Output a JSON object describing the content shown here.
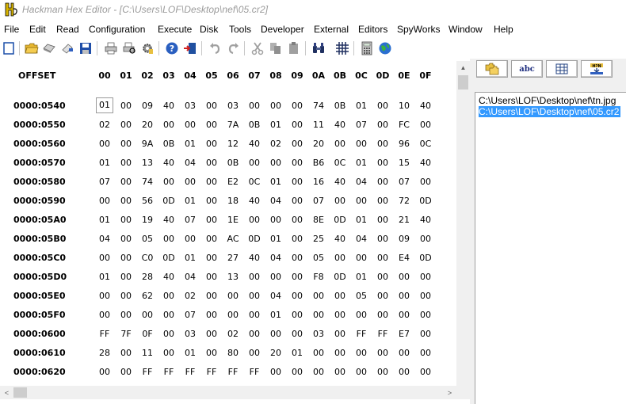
{
  "window": {
    "title": "Hackman Hex Editor - [C:\\Users\\LOF\\Desktop\\nef\\05.cr2]"
  },
  "menu": [
    "File",
    "Edit",
    "Read",
    "Configuration",
    "Execute",
    "Disk",
    "Tools",
    "Developer",
    "External",
    "Editors",
    "SpyWorks",
    "Window",
    "Help"
  ],
  "toolbar": {
    "icons": [
      "new-file-icon",
      "open-folder-icon",
      "disk-icon",
      "eraser-icon",
      "save-icon",
      "print-icon",
      "print-preview-icon",
      "settings-icon",
      "help-icon",
      "exit-icon",
      "undo-icon",
      "redo-icon",
      "cut-icon",
      "copy-icon",
      "paste-icon",
      "find-icon",
      "grid-icon",
      "calculator-icon",
      "globe-icon"
    ]
  },
  "hex": {
    "offset_header": "OFFSET",
    "columns": [
      "00",
      "01",
      "02",
      "03",
      "04",
      "05",
      "06",
      "07",
      "08",
      "09",
      "0A",
      "0B",
      "0C",
      "0D",
      "0E",
      "0F"
    ],
    "rows": [
      {
        "offset": "0000:0540",
        "bytes": [
          "01",
          "00",
          "09",
          "40",
          "03",
          "00",
          "03",
          "00",
          "00",
          "00",
          "74",
          "0B",
          "01",
          "00",
          "10",
          "40"
        ]
      },
      {
        "offset": "0000:0550",
        "bytes": [
          "02",
          "00",
          "20",
          "00",
          "00",
          "00",
          "7A",
          "0B",
          "01",
          "00",
          "11",
          "40",
          "07",
          "00",
          "FC",
          "00"
        ]
      },
      {
        "offset": "0000:0560",
        "bytes": [
          "00",
          "00",
          "9A",
          "0B",
          "01",
          "00",
          "12",
          "40",
          "02",
          "00",
          "20",
          "00",
          "00",
          "00",
          "96",
          "0C"
        ]
      },
      {
        "offset": "0000:0570",
        "bytes": [
          "01",
          "00",
          "13",
          "40",
          "04",
          "00",
          "0B",
          "00",
          "00",
          "00",
          "B6",
          "0C",
          "01",
          "00",
          "15",
          "40"
        ]
      },
      {
        "offset": "0000:0580",
        "bytes": [
          "07",
          "00",
          "74",
          "00",
          "00",
          "00",
          "E2",
          "0C",
          "01",
          "00",
          "16",
          "40",
          "04",
          "00",
          "07",
          "00"
        ]
      },
      {
        "offset": "0000:0590",
        "bytes": [
          "00",
          "00",
          "56",
          "0D",
          "01",
          "00",
          "18",
          "40",
          "04",
          "00",
          "07",
          "00",
          "00",
          "00",
          "72",
          "0D"
        ]
      },
      {
        "offset": "0000:05A0",
        "bytes": [
          "01",
          "00",
          "19",
          "40",
          "07",
          "00",
          "1E",
          "00",
          "00",
          "00",
          "8E",
          "0D",
          "01",
          "00",
          "21",
          "40"
        ]
      },
      {
        "offset": "0000:05B0",
        "bytes": [
          "04",
          "00",
          "05",
          "00",
          "00",
          "00",
          "AC",
          "0D",
          "01",
          "00",
          "25",
          "40",
          "04",
          "00",
          "09",
          "00"
        ]
      },
      {
        "offset": "0000:05C0",
        "bytes": [
          "00",
          "00",
          "C0",
          "0D",
          "01",
          "00",
          "27",
          "40",
          "04",
          "00",
          "05",
          "00",
          "00",
          "00",
          "E4",
          "0D"
        ]
      },
      {
        "offset": "0000:05D0",
        "bytes": [
          "01",
          "00",
          "28",
          "40",
          "04",
          "00",
          "13",
          "00",
          "00",
          "00",
          "F8",
          "0D",
          "01",
          "00",
          "00",
          "00"
        ]
      },
      {
        "offset": "0000:05E0",
        "bytes": [
          "00",
          "00",
          "62",
          "00",
          "02",
          "00",
          "00",
          "00",
          "04",
          "00",
          "00",
          "00",
          "05",
          "00",
          "00",
          "00"
        ]
      },
      {
        "offset": "0000:05F0",
        "bytes": [
          "00",
          "00",
          "00",
          "00",
          "07",
          "00",
          "00",
          "00",
          "01",
          "00",
          "00",
          "00",
          "00",
          "00",
          "00",
          "00"
        ]
      },
      {
        "offset": "0000:0600",
        "bytes": [
          "FF",
          "7F",
          "0F",
          "00",
          "03",
          "00",
          "02",
          "00",
          "00",
          "00",
          "03",
          "00",
          "FF",
          "FF",
          "E7",
          "00"
        ]
      },
      {
        "offset": "0000:0610",
        "bytes": [
          "28",
          "00",
          "11",
          "00",
          "01",
          "00",
          "80",
          "00",
          "20",
          "01",
          "00",
          "00",
          "00",
          "00",
          "00",
          "00"
        ]
      },
      {
        "offset": "0000:0620",
        "bytes": [
          "00",
          "00",
          "FF",
          "FF",
          "FF",
          "FF",
          "FF",
          "FF",
          "00",
          "00",
          "00",
          "00",
          "00",
          "00",
          "00",
          "00"
        ]
      }
    ]
  },
  "side_panel": {
    "tabs": [
      {
        "name": "files-tab",
        "icon": "folders-icon"
      },
      {
        "name": "text-tab",
        "label": "abc"
      },
      {
        "name": "table-tab",
        "icon": "table-icon"
      },
      {
        "name": "hex-tab",
        "icon": "hex-convert-icon"
      }
    ],
    "files": [
      {
        "path": "C:\\Users\\LOF\\Desktop\\nef\\tn.jpg",
        "selected": false
      },
      {
        "path": "C:\\Users\\LOF\\Desktop\\nef\\05.cr2",
        "selected": true
      }
    ]
  },
  "colors": {
    "selection": "#3399ff",
    "title_text": "#9a9a9a"
  }
}
